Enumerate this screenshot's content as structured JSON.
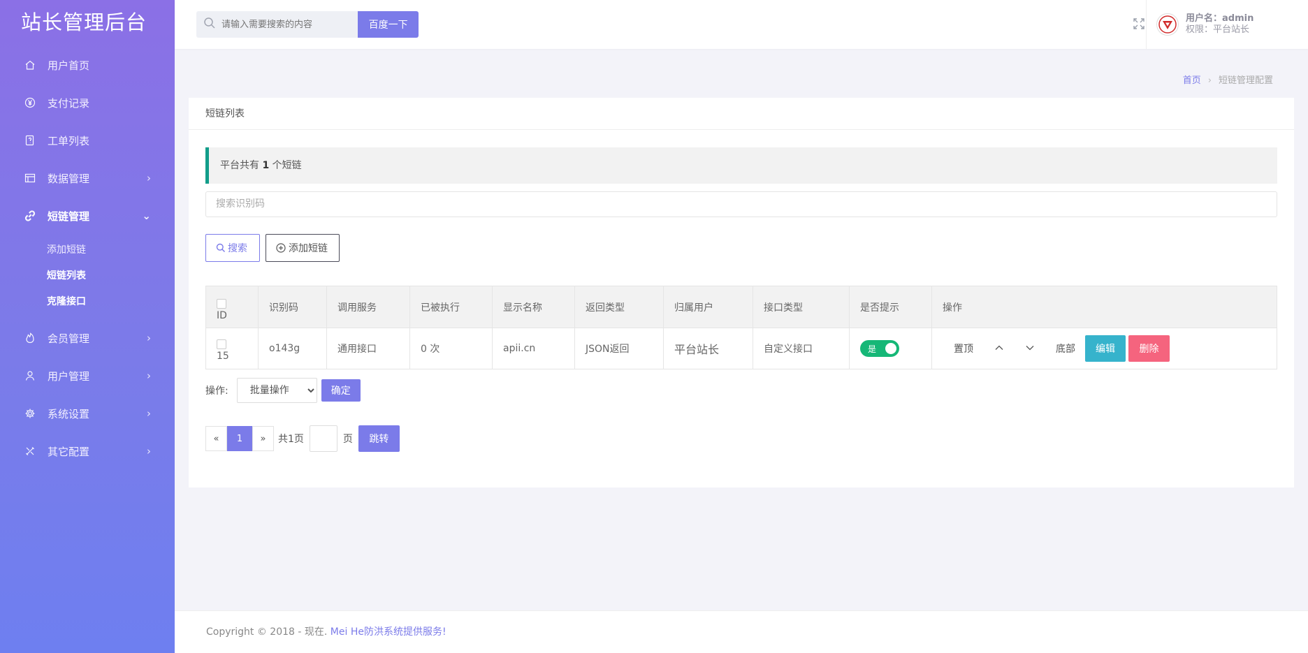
{
  "brand": "站长管理后台",
  "sidebar": {
    "items": [
      {
        "label": "用户首页"
      },
      {
        "label": "支付记录"
      },
      {
        "label": "工单列表"
      },
      {
        "label": "数据管理"
      },
      {
        "label": "短链管理"
      },
      {
        "label": "会员管理"
      },
      {
        "label": "用户管理"
      },
      {
        "label": "系统设置"
      },
      {
        "label": "其它配置"
      }
    ],
    "sub_items": [
      {
        "label": "添加短链"
      },
      {
        "label": "短链列表"
      },
      {
        "label": "克隆接口"
      }
    ]
  },
  "header": {
    "search_placeholder": "请输入需要搜索的内容",
    "search_button": "百度一下",
    "user_name": "用户名：admin",
    "user_role": "权限：平台站长"
  },
  "breadcrumb": {
    "home": "首页",
    "sep": "›",
    "current": "短链管理配置"
  },
  "card": {
    "title": "短链列表",
    "notice_prefix": "平台共有 ",
    "notice_count": "1",
    "notice_suffix": " 个短链",
    "filter_placeholder": "搜索识别码",
    "search_btn": "搜索",
    "add_btn": "添加短链"
  },
  "table": {
    "headers": [
      "ID",
      "识别码",
      "调用服务",
      "已被执行",
      "显示名称",
      "返回类型",
      "归属用户",
      "接口类型",
      "是否提示",
      "操作"
    ],
    "rows": [
      {
        "id": "15",
        "code": "o143g",
        "service": "通用接口",
        "executed": "0 次",
        "display_name": "apii.cn",
        "return_type": "JSON返回",
        "owner": "平台站长",
        "api_type": "自定义接口",
        "prompt": "是",
        "op_top": "置顶",
        "op_bottom": "底部",
        "op_edit": "编辑",
        "op_delete": "删除"
      }
    ]
  },
  "batch": {
    "label": "操作:",
    "select_value": "批量操作",
    "confirm": "确定"
  },
  "pager": {
    "prev": "«",
    "current": "1",
    "next": "»",
    "total": "共1页",
    "unit": "页",
    "jump": "跳转"
  },
  "footer": {
    "prefix": "Copyright © 2018 - 现在. ",
    "link": "Mei He防洪系统提供服务!"
  },
  "colors": {
    "accent": "#7b7be9",
    "sidebar_top": "#8b70e6",
    "sidebar_bottom": "#6e7ff0",
    "notice_border": "#129d8a",
    "edit": "#36b3cc",
    "delete": "#f5647e",
    "switch_on": "#16b777"
  }
}
